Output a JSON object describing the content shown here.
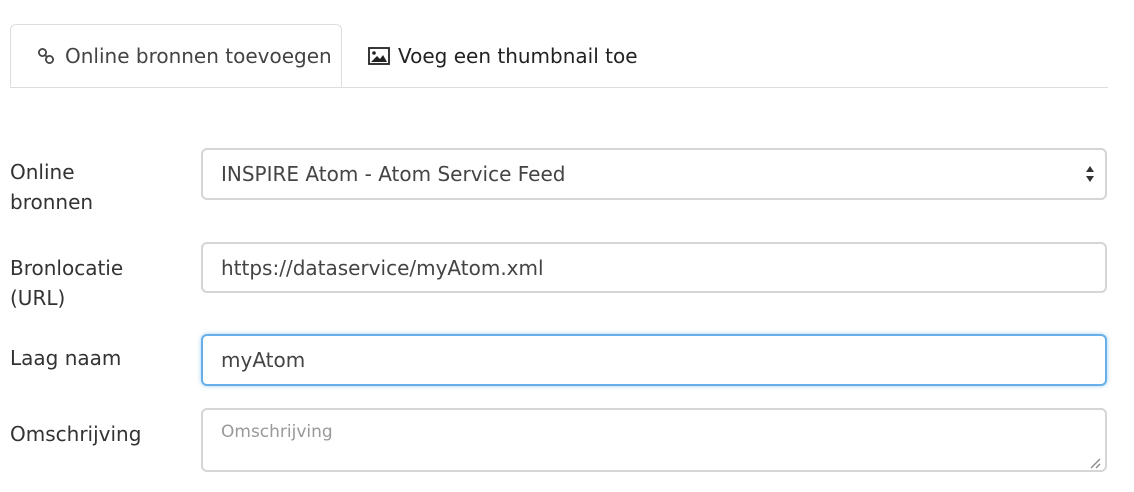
{
  "tabs": [
    {
      "label": "Online bronnen toevoegen",
      "icon": "link-icon",
      "active": true
    },
    {
      "label": "Voeg een thumbnail toe",
      "icon": "image-icon",
      "active": false
    }
  ],
  "form": {
    "online_bronnen": {
      "label": "Online bronnen",
      "selected": "INSPIRE Atom - Atom Service Feed"
    },
    "bronlocatie": {
      "label": "Bronlocatie (URL)",
      "value": "https://dataservice/myAtom.xml"
    },
    "laag_naam": {
      "label": "Laag naam",
      "value": "myAtom"
    },
    "omschrijving": {
      "label": "Omschrijving",
      "placeholder": "Omschrijving"
    }
  },
  "colors": {
    "focus_border": "#66afe9",
    "input_border": "#d5d5d5",
    "tab_border": "#dddddd"
  }
}
